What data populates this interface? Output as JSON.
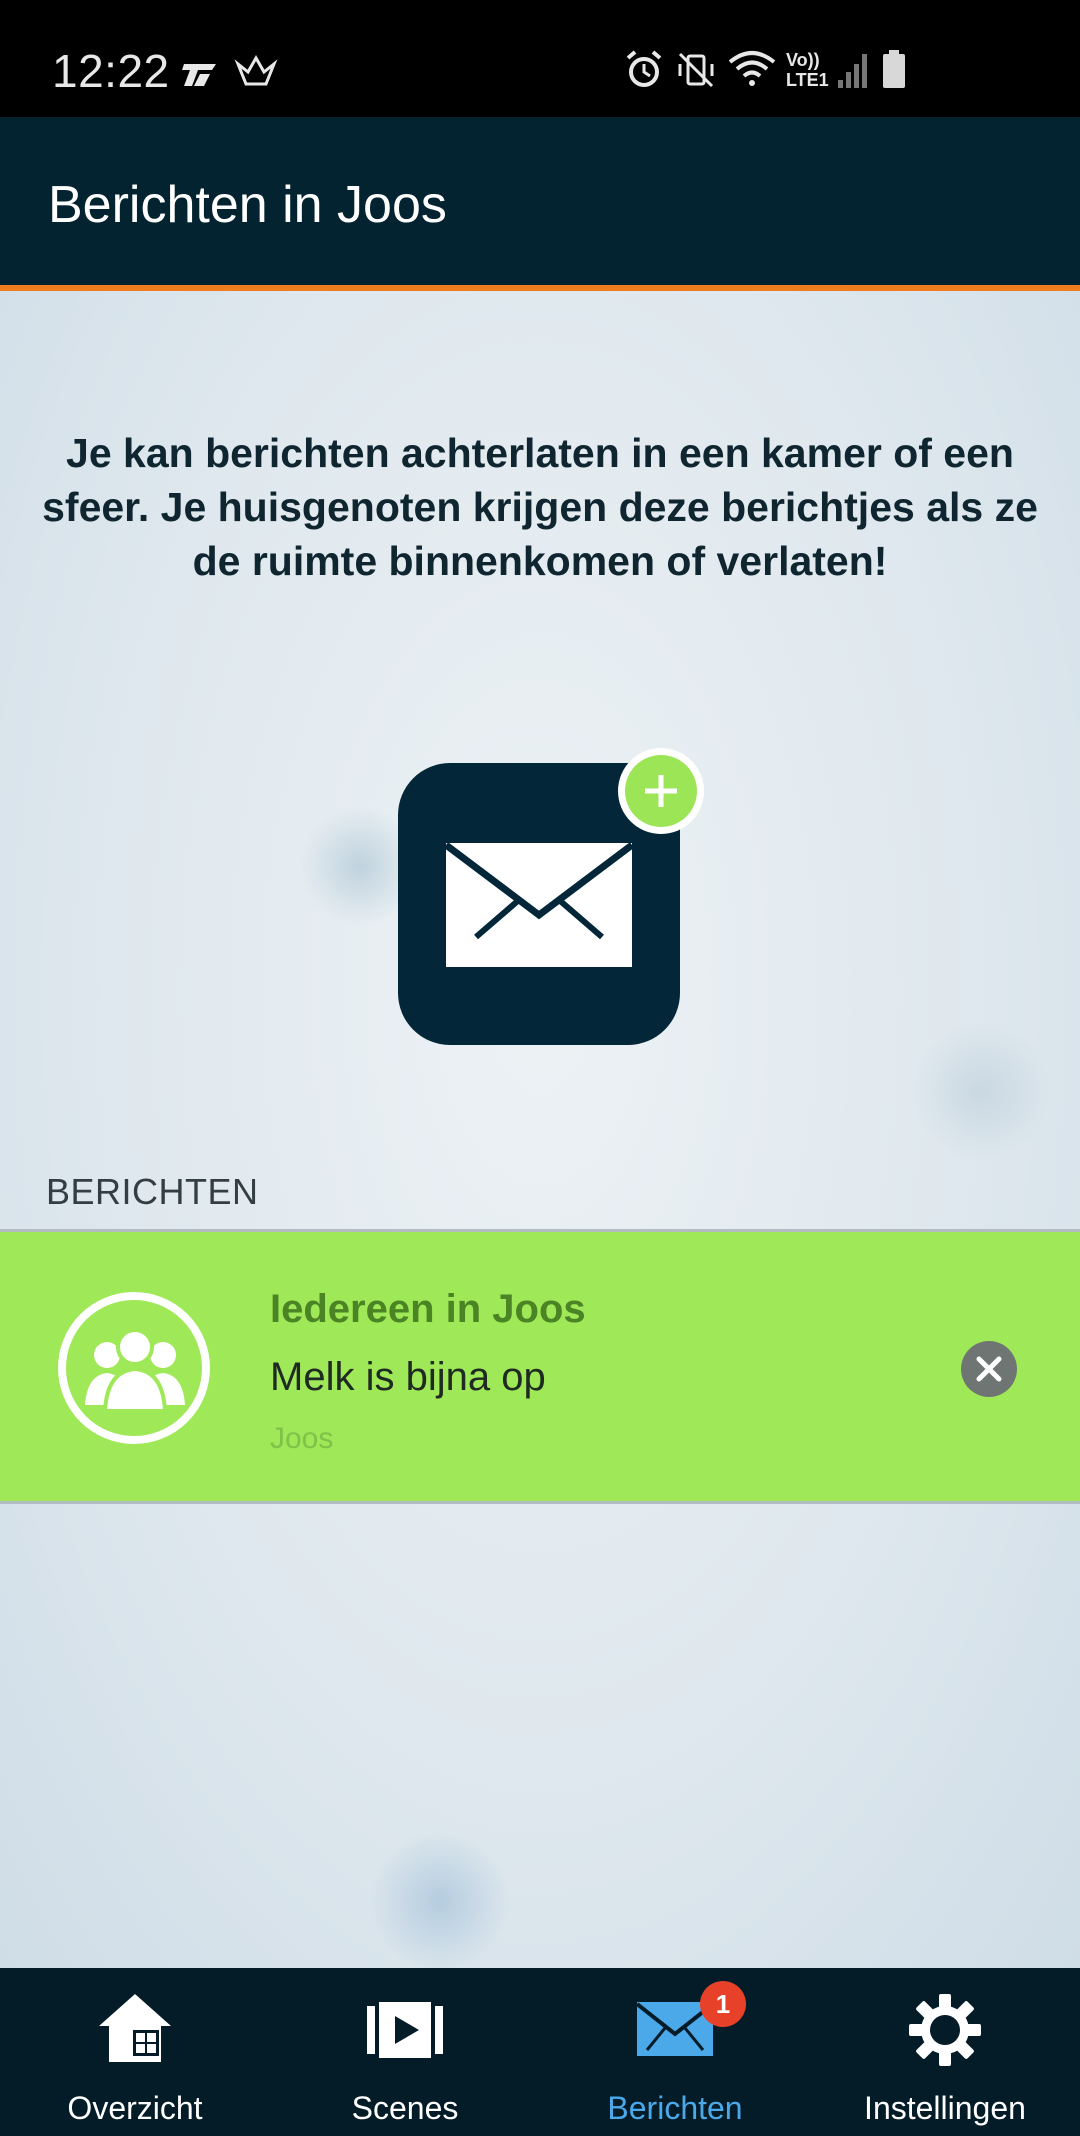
{
  "status_bar": {
    "time": "12:22",
    "icons": [
      "app-notification-icon",
      "app-notification-icon-2",
      "alarm-icon",
      "vibrate-icon",
      "wifi-icon",
      "volte-lte-icon",
      "signal-icon",
      "battery-icon"
    ],
    "network_label_top": "Vo))",
    "network_label_bottom": "LTE1"
  },
  "app_bar": {
    "title": "Berichten in Joos"
  },
  "content": {
    "intro": "Je kan berichten achterlaten in een kamer of een sfeer. Je huisgenoten krijgen deze berichtjes als ze de ruimte binnenkomen of verlaten!",
    "compose_icon": "envelope-add-icon",
    "section_label": "BERICHTEN",
    "messages": [
      {
        "recipient": "Iedereen in Joos",
        "text": "Melk is bijna op",
        "sender": "Joos",
        "avatar_icon": "group-icon"
      }
    ]
  },
  "bottom_nav": {
    "items": [
      {
        "label": "Overzicht",
        "icon": "home-icon"
      },
      {
        "label": "Scenes",
        "icon": "play-icon"
      },
      {
        "label": "Berichten",
        "icon": "mail-icon",
        "badge": "1",
        "active": true
      },
      {
        "label": "Instellingen",
        "icon": "gear-icon"
      }
    ]
  },
  "colors": {
    "app_bar": "#032330",
    "accent": "#f07d1d",
    "message_bg": "#9fe857",
    "active_tab": "#4ba9ea",
    "badge": "#e8412a"
  }
}
